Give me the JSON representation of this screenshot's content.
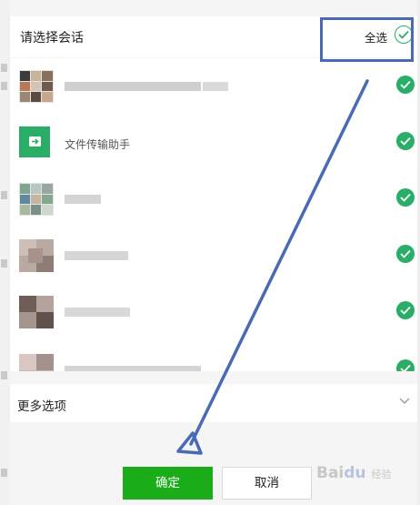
{
  "header": {
    "title": "请选择会话",
    "select_all": "全选"
  },
  "contacts": [
    {
      "name": ""
    },
    {
      "name": "文件传输助手"
    },
    {
      "name": ""
    },
    {
      "name": ""
    },
    {
      "name": ""
    },
    {
      "name": ""
    }
  ],
  "more_options": {
    "label": "更多选项"
  },
  "buttons": {
    "confirm": "确定",
    "cancel": "取消"
  },
  "colors": {
    "accent": "#2aae67",
    "confirm_bg": "#1aad19",
    "annotation": "#4a6ab5"
  },
  "icons": {
    "checkmark": "check-icon",
    "file_transfer": "file-transfer-icon",
    "chevron": "chevron-down-icon"
  }
}
